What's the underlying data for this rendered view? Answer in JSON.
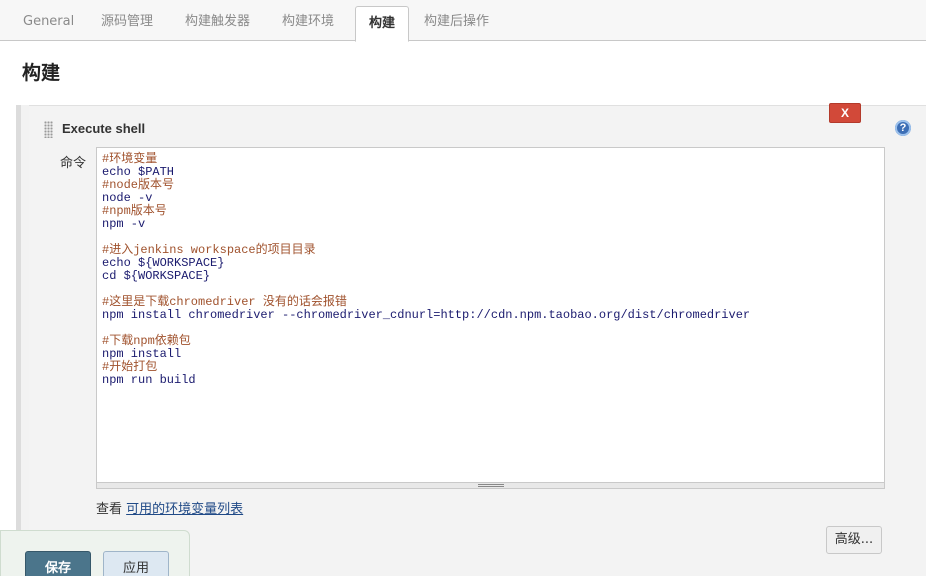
{
  "tabs": [
    {
      "label": "General"
    },
    {
      "label": "源码管理"
    },
    {
      "label": "构建触发器"
    },
    {
      "label": "构建环境"
    },
    {
      "label": "构建"
    },
    {
      "label": "构建后操作"
    }
  ],
  "active_tab": "构建",
  "page_heading": "构建",
  "step": {
    "title": "Execute shell",
    "delete_label": "X",
    "help_label": "?",
    "command_label": "命令",
    "command_lines": [
      "#环境变量",
      "echo $PATH",
      "#node版本号",
      "node -v",
      "#npm版本号",
      "npm -v",
      "",
      "#进入jenkins workspace的项目目录",
      "echo ${WORKSPACE}",
      "cd ${WORKSPACE}",
      "",
      "#这里是下载chromedriver 没有的话会报错",
      "npm install chromedriver --chromedriver_cdnurl=http://cdn.npm.taobao.org/dist/chromedriver",
      "",
      "#下载npm依赖包",
      "npm install",
      "#开始打包",
      "npm run build"
    ],
    "env_prefix": "查看",
    "env_link": "可用的环境变量列表",
    "advanced_label": "高级..."
  },
  "footer": {
    "save_label": "保存",
    "apply_label": "应用"
  },
  "colors": {
    "accent": "#4b758b",
    "delete": "#d24939",
    "help": "#3d6fb6",
    "comment": "#a0522d"
  }
}
